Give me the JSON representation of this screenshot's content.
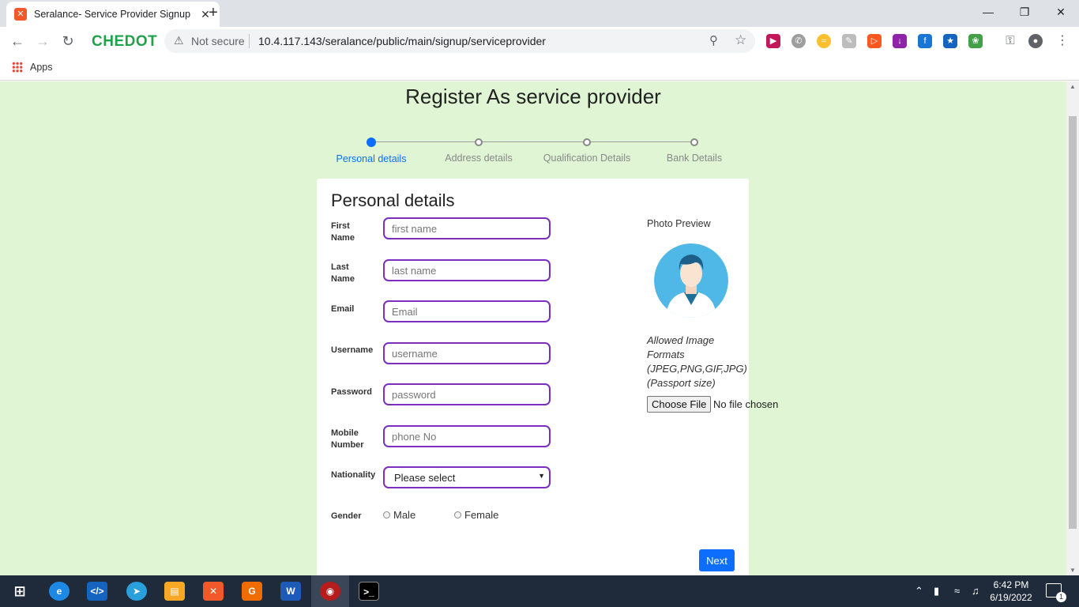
{
  "browser": {
    "tab_title": "Seralance- Service Provider Signup",
    "tab_close": "✕",
    "new_tab": "+",
    "brand": "CHEDOT",
    "security_label": "Not secure",
    "url": "10.4.117.143/seralance/public/main/signup/serviceprovider",
    "bookmarks": {
      "apps_label": "Apps"
    }
  },
  "page": {
    "title": "Register As service provider",
    "steps": [
      {
        "label": "Personal details",
        "active": true
      },
      {
        "label": "Address details",
        "active": false
      },
      {
        "label": "Qualification Details",
        "active": false
      },
      {
        "label": "Bank Details",
        "active": false
      }
    ],
    "form": {
      "heading": "Personal details",
      "fields": [
        {
          "label": "First Name",
          "placeholder": "first name"
        },
        {
          "label": "Last Name",
          "placeholder": "last name"
        },
        {
          "label": "Email",
          "placeholder": "Email"
        },
        {
          "label": "Username",
          "placeholder": "username"
        },
        {
          "label": "Password",
          "placeholder": "password"
        },
        {
          "label": "Mobile Number",
          "placeholder": "phone No"
        }
      ],
      "nationality": {
        "label": "Nationality",
        "value": "Please select"
      },
      "gender": {
        "label": "Gender",
        "options": [
          "Male",
          "Female"
        ]
      },
      "photo": {
        "title": "Photo Preview",
        "allowed_text": "Allowed Image Formats (JPEG,PNG,GIF,JPG) (Passport size)",
        "choose_label": "Choose File",
        "no_file": "No file chosen"
      },
      "next_label": "Next"
    }
  },
  "taskbar": {
    "time": "6:42 PM",
    "date": "6/19/2022",
    "notification_count": "1"
  },
  "colors": {
    "page_bg": "#dff5d4",
    "accent": "#0d6efd",
    "field_border": "#7b2fbf"
  }
}
